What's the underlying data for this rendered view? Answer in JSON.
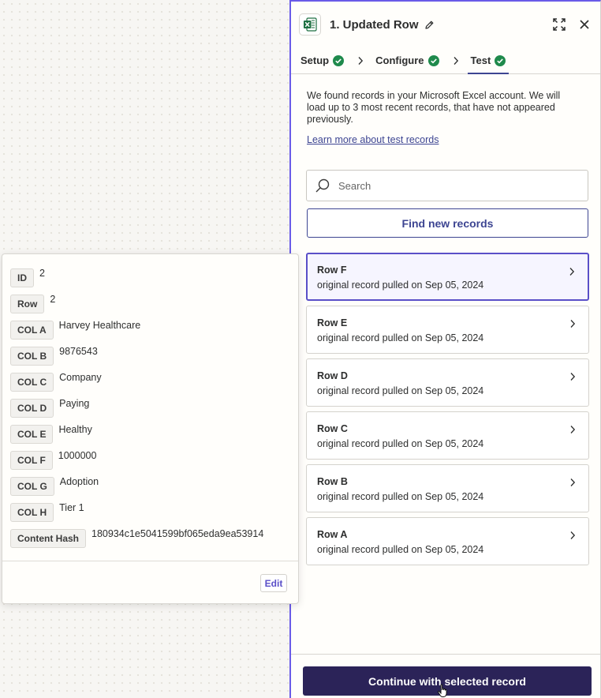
{
  "panel": {
    "app_icon": "microsoft-excel-icon",
    "title": "1. Updated Row",
    "tabs": [
      {
        "label": "Setup",
        "status": "complete"
      },
      {
        "label": "Configure",
        "status": "complete"
      },
      {
        "label": "Test",
        "status": "complete",
        "active": true
      }
    ],
    "intro": "We found records in your Microsoft Excel account. We will load up to 3 most recent records, that have not appeared previously.",
    "learn_link": "Learn more about test records",
    "search_placeholder": "Search",
    "find_button": "Find new records",
    "records": [
      {
        "title": "Row F",
        "subtitle": "original record pulled on Sep 05, 2024",
        "selected": true
      },
      {
        "title": "Row E",
        "subtitle": "original record pulled on Sep 05, 2024"
      },
      {
        "title": "Row D",
        "subtitle": "original record pulled on Sep 05, 2024"
      },
      {
        "title": "Row C",
        "subtitle": "original record pulled on Sep 05, 2024"
      },
      {
        "title": "Row B",
        "subtitle": "original record pulled on Sep 05, 2024"
      },
      {
        "title": "Row A",
        "subtitle": "original record pulled on Sep 05, 2024"
      }
    ],
    "continue_button": "Continue with selected record"
  },
  "popover": {
    "fields": [
      {
        "key": "ID",
        "value": "2"
      },
      {
        "key": "Row",
        "value": "2"
      },
      {
        "key": "COL A",
        "value": "Harvey Healthcare"
      },
      {
        "key": "COL B",
        "value": "9876543"
      },
      {
        "key": "COL C",
        "value": "Company"
      },
      {
        "key": "COL D",
        "value": "Paying"
      },
      {
        "key": "COL E",
        "value": "Healthy"
      },
      {
        "key": "COL F",
        "value": "1000000"
      },
      {
        "key": "COL G",
        "value": "Adoption"
      },
      {
        "key": "COL H",
        "value": "Tier 1"
      },
      {
        "key": "Content Hash",
        "value": "180934c1e5041599bf065eda9ea53914"
      }
    ],
    "edit_label": "Edit"
  },
  "colors": {
    "accent": "#695be8",
    "primary_dark": "#2b2358",
    "link": "#3d4592",
    "success": "#1f8a4c",
    "excel_green": "#1d6f42"
  }
}
